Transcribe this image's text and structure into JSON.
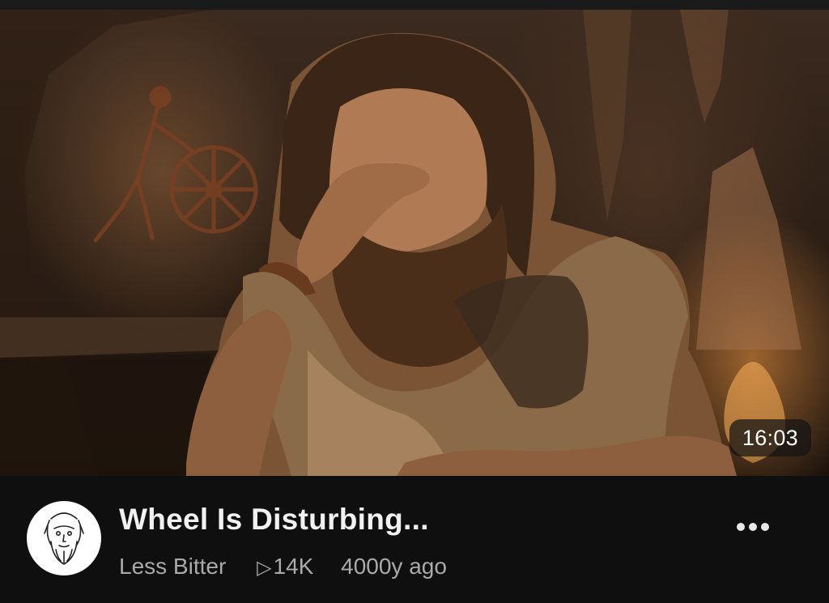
{
  "video": {
    "title": "Wheel Is Disturbing...",
    "duration": "16:03"
  },
  "channel": {
    "name": "Less Bitter",
    "avatar_icon": "bearded-man-sketch-icon"
  },
  "stats": {
    "views": "14K",
    "views_icon": "play-outline-icon",
    "age": "4000y ago"
  },
  "menu": {
    "icon": "more-options-icon"
  },
  "colors": {
    "background": "#0f0f0f",
    "title": "#f1f1f1",
    "meta": "#aaaaaa",
    "badge_bg": "#141414"
  }
}
